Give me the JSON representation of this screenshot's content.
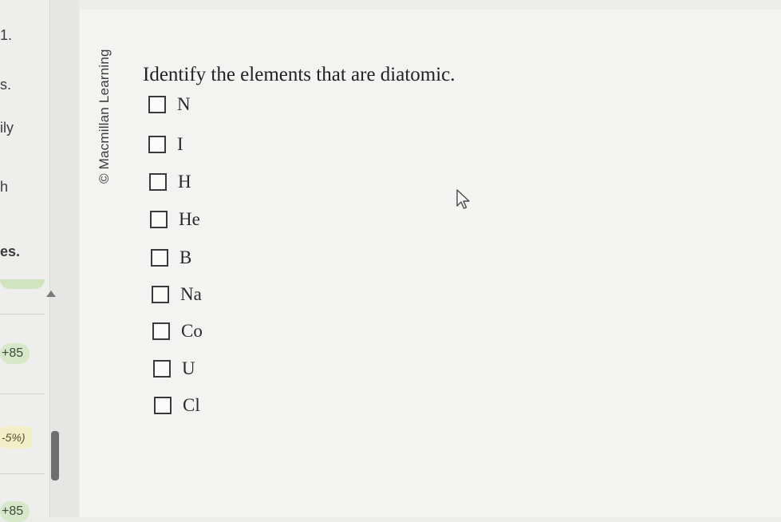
{
  "left_panel": {
    "fragments": [
      "1.",
      "s.",
      "ily",
      "h",
      "es."
    ],
    "score_1": "+85",
    "percent": "-5%)",
    "score_2": "+85"
  },
  "credit": "© Macmillan Learning",
  "question": "Identify the elements that are diatomic.",
  "options": [
    "N",
    "I",
    "H",
    "He",
    "B",
    "Na",
    "Co",
    "U",
    "Cl"
  ]
}
